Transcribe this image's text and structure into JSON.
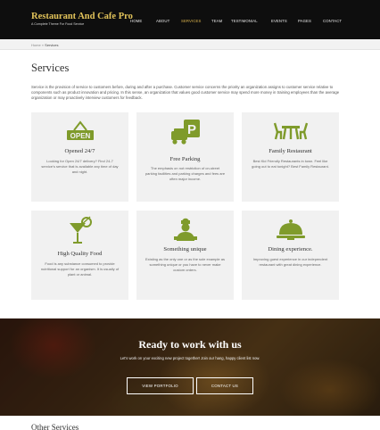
{
  "brand": {
    "title": "Restaurant And Cafe Pro",
    "tagline": "A Complete Theme For Food Service"
  },
  "nav": {
    "items": [
      {
        "label": "HOME"
      },
      {
        "label": "ABOUT"
      },
      {
        "label": "SERVICES",
        "active": true
      },
      {
        "label": "TEAM"
      },
      {
        "label": "TESTIMONIAL"
      },
      {
        "label": "EVENTS"
      },
      {
        "label": "PAGES"
      },
      {
        "label": "CONTACT"
      }
    ]
  },
  "breadcrumb": {
    "home": "Home",
    "separator": "»",
    "current": "Services"
  },
  "page": {
    "title": "Services",
    "intro": "Service is the provision of service to customers before, during and after a purchase. Customer service concerns the priority an organization assigns to customer service relative to components such as product innovation and pricing. In this sense, an organization that values good customer service may spend more money in training employees than the average organization or may proactively interview customers for feedback."
  },
  "services": [
    {
      "icon": "open-sign-icon",
      "title": "Opened 24/7",
      "text": "Looking for Open 24/7 delivery? Find 24-7 service's service that is available any time of day and night."
    },
    {
      "icon": "parking-icon",
      "title": "Free Parking",
      "text": "The emphasis on not restriction of on-street parking facilities and parking charges and fees are often major income."
    },
    {
      "icon": "kids-table-icon",
      "title": "Family Restaurant",
      "text": "Best Kid Friendly Restaurants in town. Feel like going out to eat tonight? Best Family Restaurant."
    },
    {
      "icon": "cocktail-icon",
      "title": "High Quality Food",
      "text": "Food is any substance consumed to provide nutritional support for an organism. It is usually of plant or animal."
    },
    {
      "icon": "chef-icon",
      "title": "Something unique",
      "text": "Existing as the only one or as the sole example as something unique or you have to never make custom orders."
    },
    {
      "icon": "cloche-icon",
      "title": "Dining experience.",
      "text": "Improving guest experience in our independent restaurant with great dining experience."
    }
  ],
  "banner": {
    "title": "Ready to work with us",
    "subtitle": "Let's work on your exciting new project together! Join our hang, happy client list now.",
    "portfolio_button": "VIEW PORTFOLIO",
    "contact_button": "CONTACT US"
  },
  "other": {
    "title": "Other Services"
  },
  "colors": {
    "accent": "#d9b24c",
    "icon_green": "#7f9b2b",
    "header_bg": "#0e0e0e",
    "card_bg": "#f1f1f1"
  }
}
